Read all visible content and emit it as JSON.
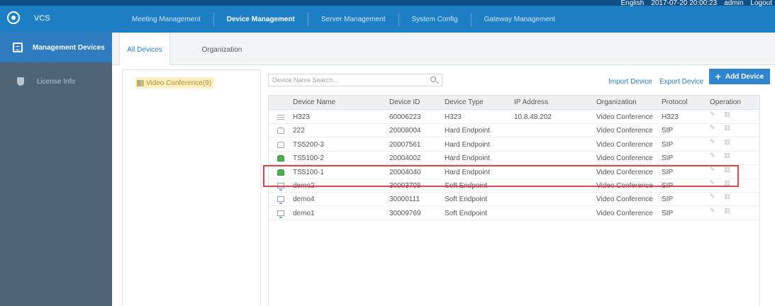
{
  "header": {
    "brand": "VCS",
    "brand_icon": "vcs-logo-icon",
    "nav": [
      {
        "label": "Meeting Management",
        "active": false
      },
      {
        "label": "Device Management",
        "active": true
      },
      {
        "label": "Server Management",
        "active": false
      },
      {
        "label": "System Config",
        "active": false
      },
      {
        "label": "Gateway Management",
        "active": false
      }
    ],
    "top_right": {
      "language": "English",
      "datetime": "2017-07-20 20:00:23",
      "user": "admin",
      "logout": "Logout"
    }
  },
  "sidebar": {
    "items": [
      {
        "label": "Management Devices",
        "icon": "document-icon",
        "active": true
      },
      {
        "label": "License Info",
        "icon": "shield-icon",
        "active": false
      }
    ]
  },
  "tabs": [
    {
      "label": "All Devices",
      "active": true
    },
    {
      "label": "Organization",
      "active": false
    }
  ],
  "tree": {
    "root_label": "Video Conference(9)"
  },
  "toolbar": {
    "search_placeholder": "Device Name Search...",
    "import_label": "Import Device",
    "export_label": "Export Device",
    "add_label": "Add Device"
  },
  "table": {
    "columns": [
      "Device Name",
      "Device ID",
      "Device Type",
      "IP Address",
      "Organization",
      "Protocol",
      "Operation"
    ],
    "rows": [
      {
        "name": "H323",
        "id": "60006223",
        "type": "H323",
        "ip": "10.8.48.202",
        "org": "Video Conference",
        "protocol": "H323",
        "icon": "h323-icon"
      },
      {
        "name": "222",
        "id": "20008004",
        "type": "Hard Endpoint",
        "ip": "",
        "org": "Video Conference",
        "protocol": "SIP",
        "icon": "hard-endpoint-icon"
      },
      {
        "name": "TS5200-3",
        "id": "20007561",
        "type": "Hard Endpoint",
        "ip": "",
        "org": "Video Conference",
        "protocol": "SIP",
        "icon": "hard-endpoint-icon"
      },
      {
        "name": "TS5100-2",
        "id": "20004002",
        "type": "Hard Endpoint",
        "ip": "",
        "org": "Video Conference",
        "protocol": "SIP",
        "icon": "hard-endpoint-online-icon"
      },
      {
        "name": "TS5100-1",
        "id": "20004040",
        "type": "Hard Endpoint",
        "ip": "",
        "org": "Video Conference",
        "protocol": "SIP",
        "icon": "hard-endpoint-online-icon"
      },
      {
        "name": "demo2",
        "id": "30003708",
        "type": "Soft Endpoint",
        "ip": "",
        "org": "Video Conference",
        "protocol": "SIP",
        "icon": "soft-endpoint-icon"
      },
      {
        "name": "demo4",
        "id": "30000111",
        "type": "Soft Endpoint",
        "ip": "",
        "org": "Video Conference",
        "protocol": "SIP",
        "icon": "soft-endpoint-icon"
      },
      {
        "name": "demo1",
        "id": "30009769",
        "type": "Soft Endpoint",
        "ip": "",
        "org": "Video Conference",
        "protocol": "SIP",
        "icon": "soft-endpoint-icon"
      }
    ],
    "highlighted_row": "TS5100-1"
  },
  "colors": {
    "accent": "#2f7dc0",
    "topbar": "#1f7fc4",
    "sidebar": "#4f6576",
    "highlight": "#d9464a"
  }
}
